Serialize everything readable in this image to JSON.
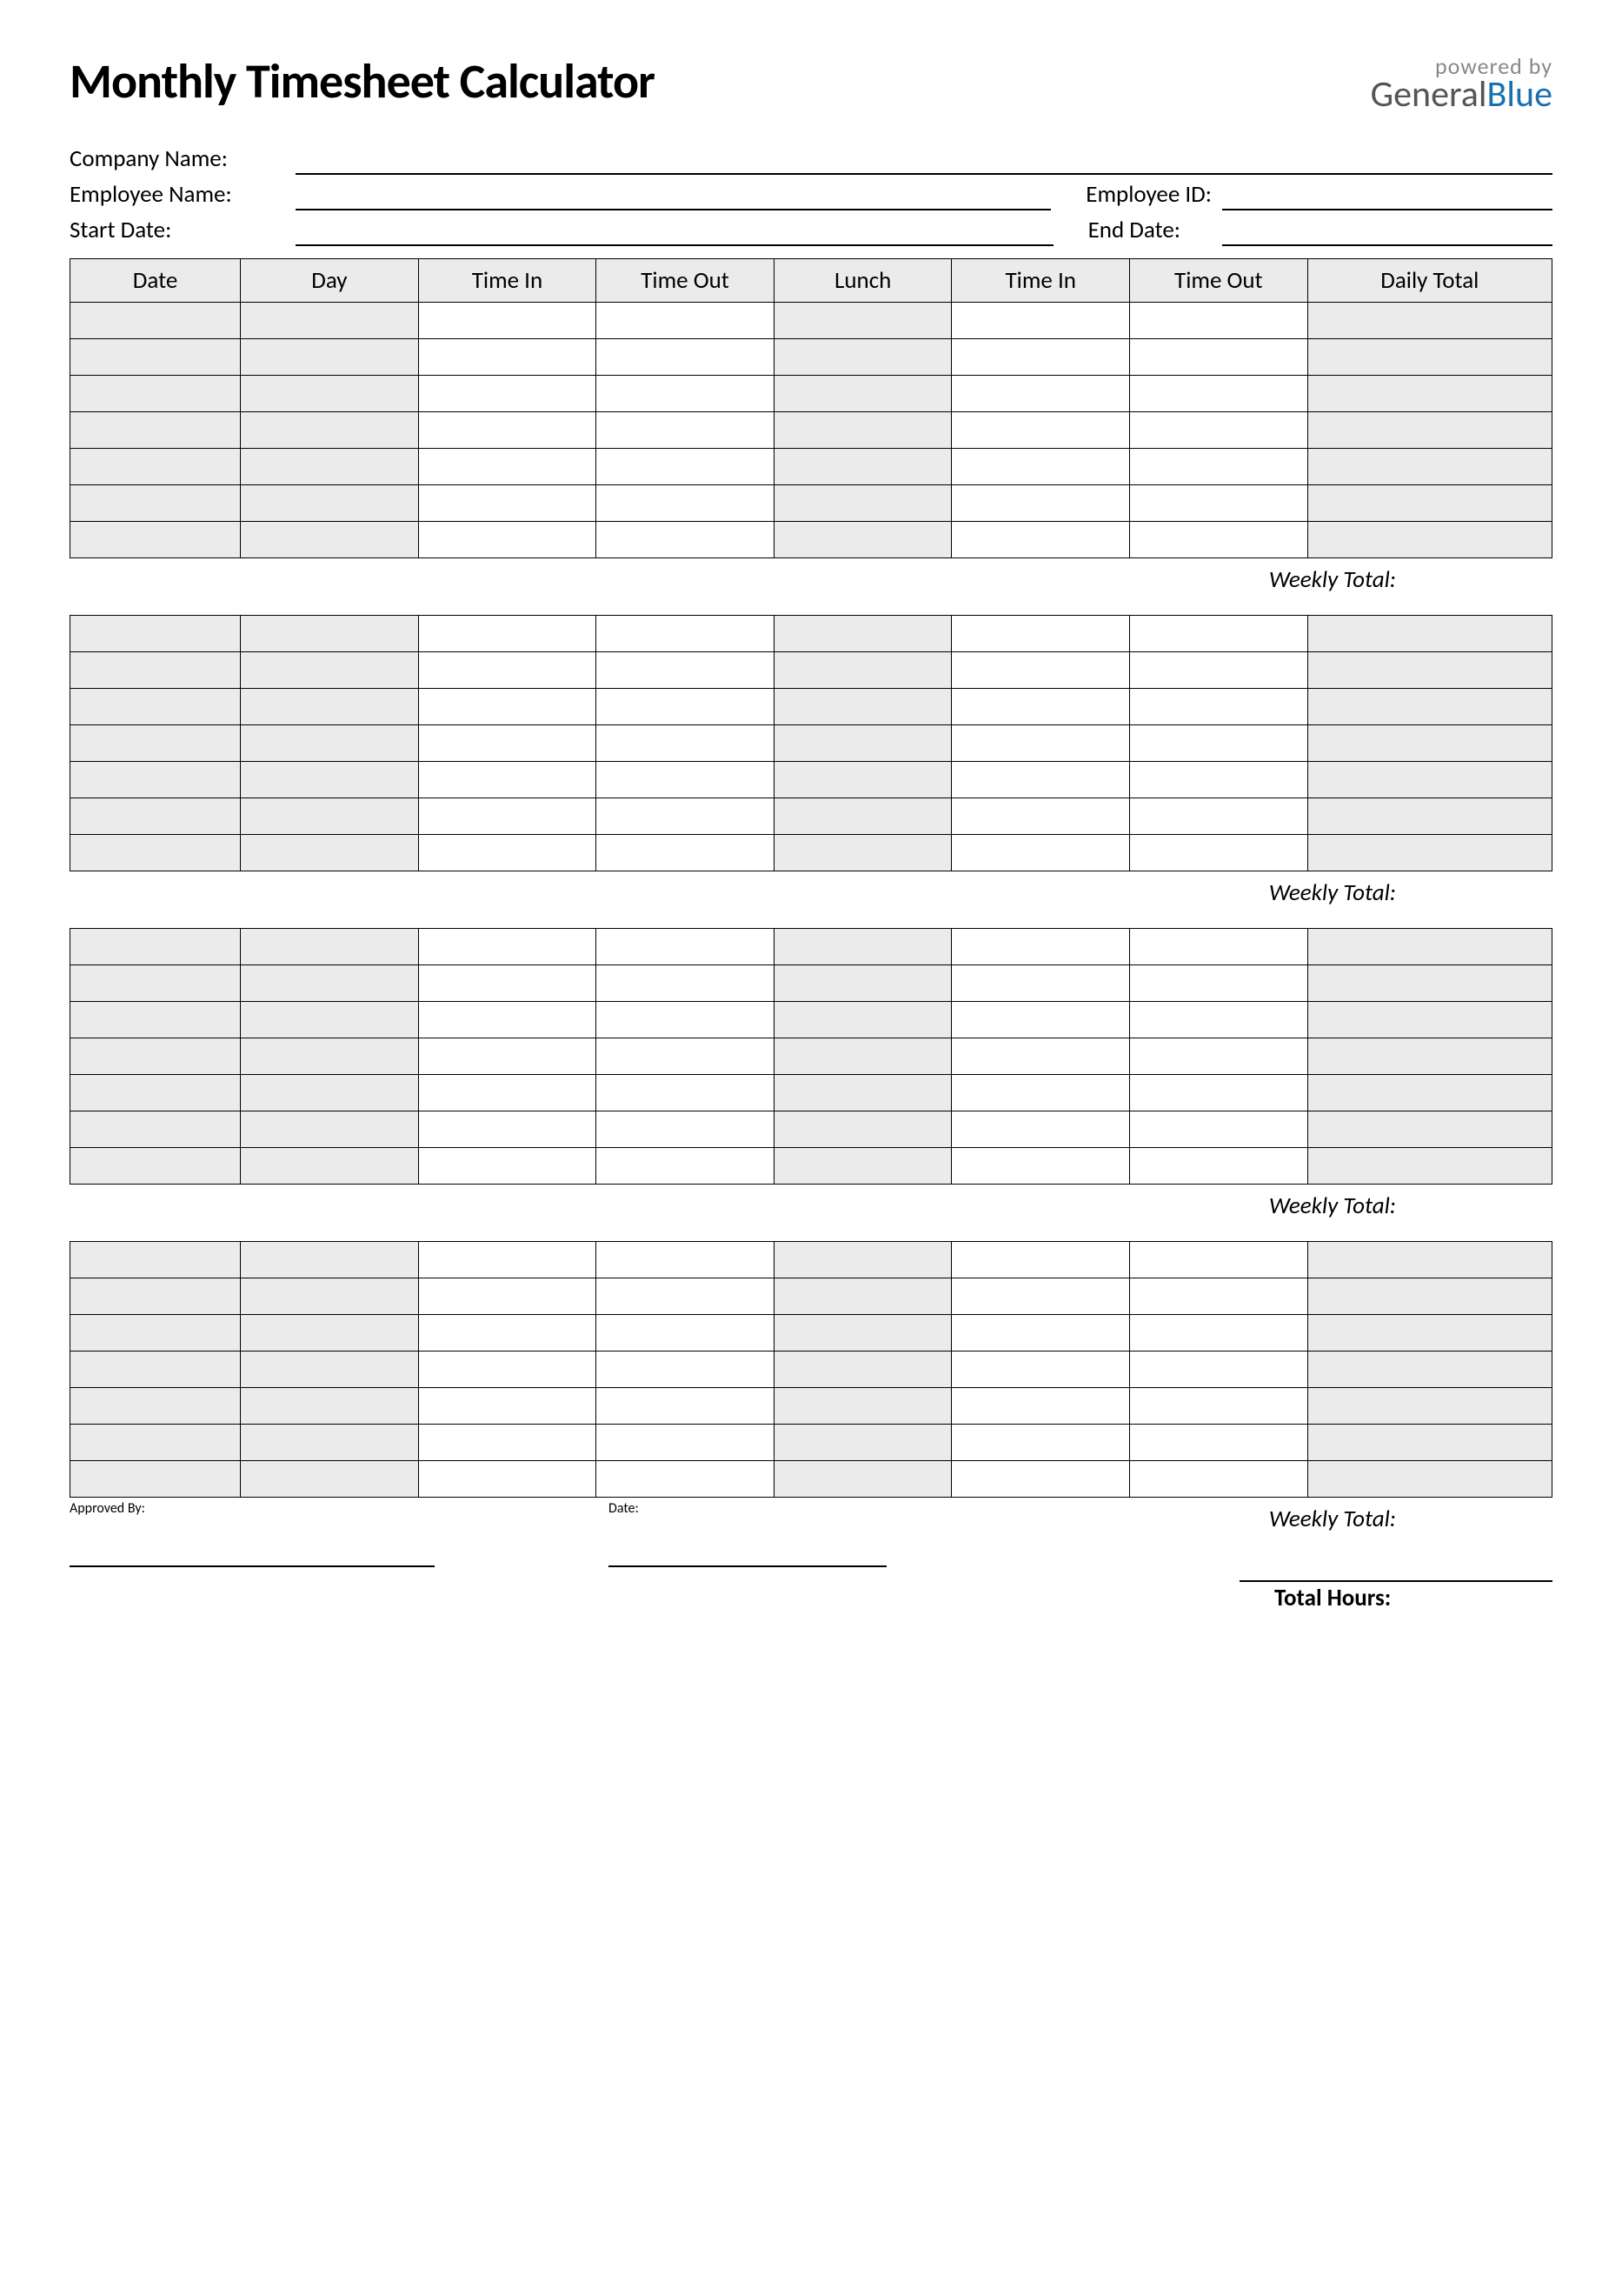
{
  "header": {
    "title": "Monthly Timesheet Calculator",
    "powered_by": "powered by",
    "brand_general": "General",
    "brand_blue": "Blue"
  },
  "info": {
    "company_name_label": "Company Name:",
    "employee_name_label": "Employee Name:",
    "employee_id_label": "Employee ID:",
    "start_date_label": "Start Date:",
    "end_date_label": "End Date:"
  },
  "columns": {
    "date": "Date",
    "day": "Day",
    "time_in": "Time In",
    "time_out": "Time Out",
    "lunch": "Lunch",
    "time_in2": "Time In",
    "time_out2": "Time Out",
    "daily_total": "Daily Total"
  },
  "weekly_total_label": "Weekly Total:",
  "footer": {
    "approved_by_label": "Approved By:",
    "date_label": "Date:",
    "total_hours_label": "Total Hours:"
  }
}
